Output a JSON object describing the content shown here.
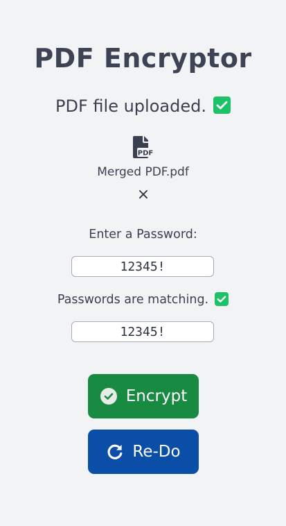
{
  "app": {
    "title": "PDF Encryptor"
  },
  "upload": {
    "status_text": "PDF file uploaded.",
    "status_icon": "check-square-icon",
    "file_icon": "pdf-file-icon",
    "file_name": "Merged PDF.pdf",
    "remove_symbol": "×"
  },
  "password": {
    "label": "Enter a Password:",
    "value": "12345!",
    "match_label": "Passwords are matching.",
    "match_icon": "check-square-icon",
    "confirm_value": "12345!"
  },
  "actions": {
    "encrypt_label": "Encrypt",
    "encrypt_icon": "check-circle-icon",
    "redo_label": "Re-Do",
    "redo_icon": "redo-arrow-icon"
  },
  "colors": {
    "background": "#f1f3f5",
    "check_green": "#1cc168",
    "encrypt_green": "#198a42",
    "redo_blue": "#0b4ea8"
  }
}
